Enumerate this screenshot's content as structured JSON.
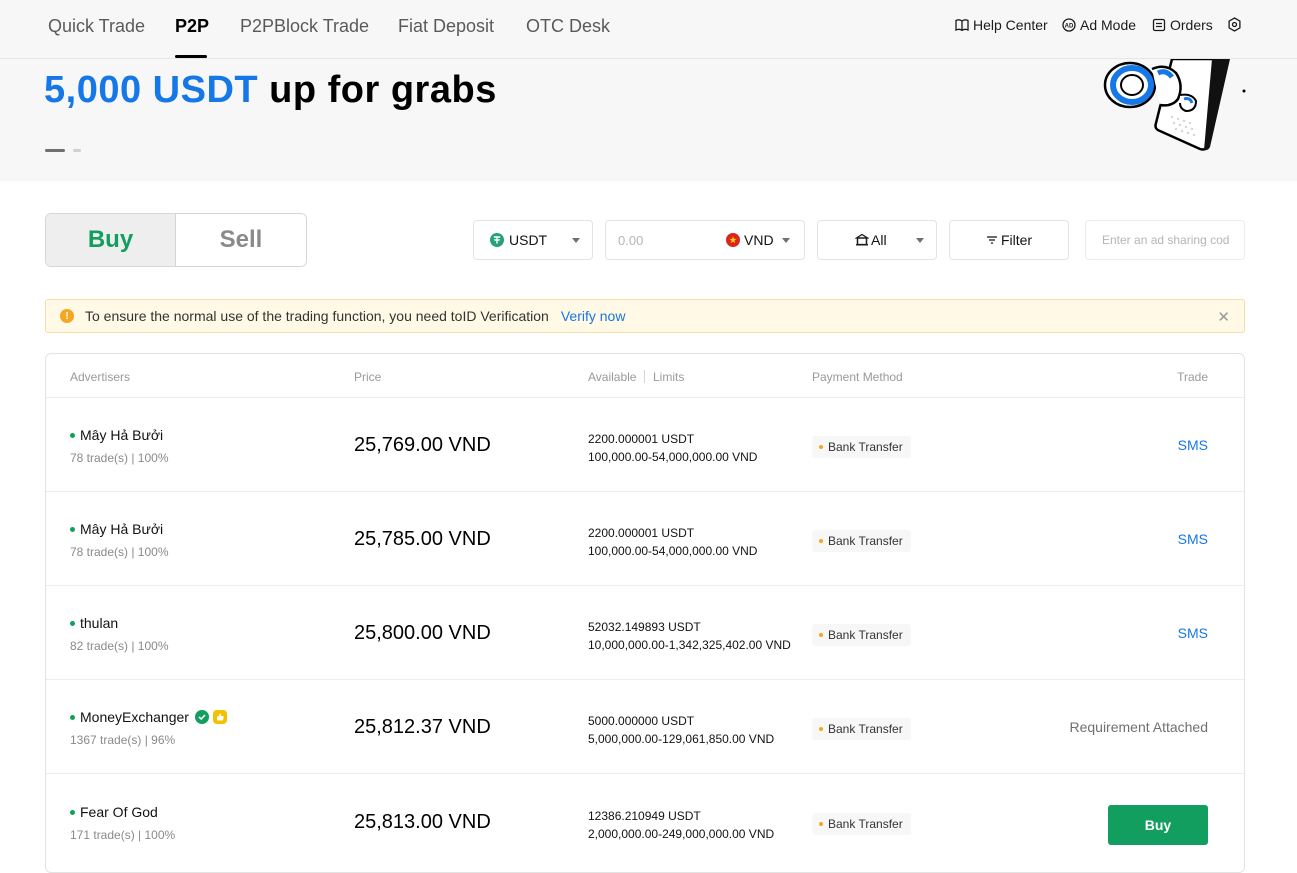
{
  "nav": {
    "tabs": [
      {
        "label": "Quick Trade"
      },
      {
        "label": "P2P"
      },
      {
        "label": "P2PBlock Trade"
      },
      {
        "label": "Fiat Deposit"
      },
      {
        "label": "OTC Desk"
      }
    ],
    "active_tab": "P2P",
    "help_center": "Help Center",
    "ad_mode": "Ad Mode",
    "orders": "Orders"
  },
  "banner": {
    "highlight": "5,000 USDT",
    "rest": " up for grabs"
  },
  "toggle": {
    "buy": "Buy",
    "sell": "Sell",
    "selected": "Buy"
  },
  "filters": {
    "crypto": "USDT",
    "amount_placeholder": "0.00",
    "fiat": "VND",
    "payment": "All",
    "filter_label": "Filter",
    "ad_code_placeholder": "Enter an ad sharing cod"
  },
  "alert": {
    "icon": "!",
    "message": "To ensure the normal use of the trading function, you need toID Verification",
    "link": "Verify now",
    "close": "✕"
  },
  "table": {
    "headers": {
      "advertisers": "Advertisers",
      "price": "Price",
      "available": "Available",
      "limits": "Limits",
      "payment_method": "Payment Method",
      "trade": "Trade"
    },
    "rows": [
      {
        "name": "Mây Hả Bưởi",
        "stats": "78 trade(s) | 100%",
        "price": "25,769.00 VND",
        "available": "2200.000001 USDT",
        "limits": "100,000.00-54,000,000.00 VND",
        "payment": "Bank Transfer",
        "action": "SMS"
      },
      {
        "name": "Mây Hả Bưởi",
        "stats": "78 trade(s) | 100%",
        "price": "25,785.00 VND",
        "available": "2200.000001 USDT",
        "limits": "100,000.00-54,000,000.00 VND",
        "payment": "Bank Transfer",
        "action": "SMS"
      },
      {
        "name": "thulan",
        "stats": "82 trade(s) | 100%",
        "price": "25,800.00 VND",
        "available": "52032.149893 USDT",
        "limits": "10,000,000.00-1,342,325,402.00 VND",
        "payment": "Bank Transfer",
        "action": "SMS"
      },
      {
        "name": "MoneyExchanger",
        "stats": "1367 trade(s) | 96%",
        "price": "25,812.37 VND",
        "available": "5000.000000 USDT",
        "limits": "5,000,000.00-129,061,850.00 VND",
        "payment": "Bank Transfer",
        "action": "Requirement Attached"
      },
      {
        "name": "Fear Of God",
        "stats": "171 trade(s) | 100%",
        "price": "25,813.00 VND",
        "available": "12386.210949 USDT",
        "limits": "2,000,000.00-249,000,000.00 VND",
        "payment": "Bank Transfer",
        "action": "Buy"
      }
    ]
  },
  "colors": {
    "buy_green": "#129e5e",
    "link_blue": "#1677e6",
    "banner_accent": "#1677e6",
    "alert_bg": "#fff9e6"
  }
}
